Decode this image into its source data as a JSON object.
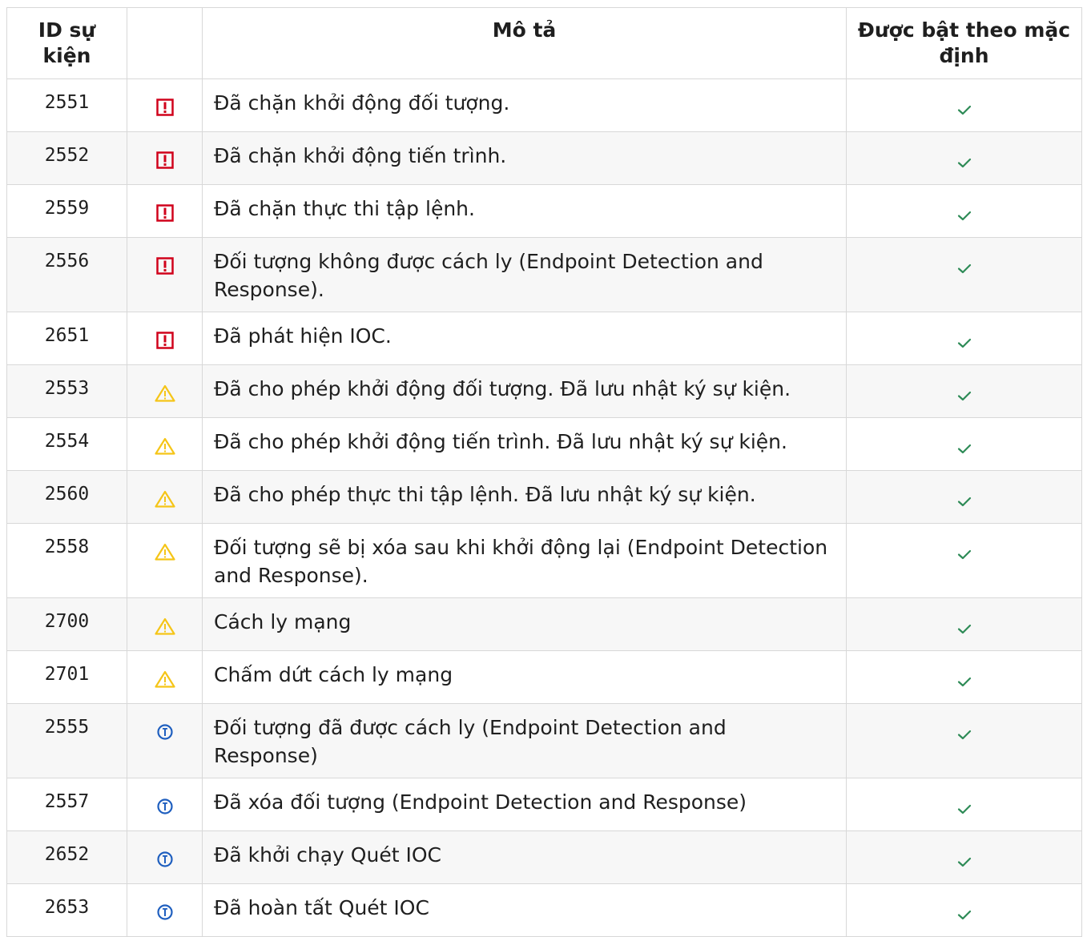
{
  "columns": {
    "event_id": "ID sự kiện",
    "icon": "",
    "description": "Mô tả",
    "enabled_by_default": "Được bật theo mặc định"
  },
  "colors": {
    "critical": "#d0021b",
    "warning": "#f5c518",
    "info": "#1f5fbf",
    "check": "#2e8b57"
  },
  "rows": [
    {
      "id": "2551",
      "severity": "critical-icon",
      "description": "Đã chặn khởi động đối tượng.",
      "enabled": "check-icon"
    },
    {
      "id": "2552",
      "severity": "critical-icon",
      "description": "Đã chặn khởi động tiến trình.",
      "enabled": "check-icon"
    },
    {
      "id": "2559",
      "severity": "critical-icon",
      "description": "Đã chặn thực thi tập lệnh.",
      "enabled": "check-icon"
    },
    {
      "id": "2556",
      "severity": "critical-icon",
      "description": "Đối tượng không được cách ly (Endpoint Detection and Response).",
      "enabled": "check-icon"
    },
    {
      "id": "2651",
      "severity": "critical-icon",
      "description": "Đã phát hiện IOC.",
      "enabled": "check-icon"
    },
    {
      "id": "2553",
      "severity": "warning-icon",
      "description": "Đã cho phép khởi động đối tượng. Đã lưu nhật ký sự kiện.",
      "enabled": "check-icon"
    },
    {
      "id": "2554",
      "severity": "warning-icon",
      "description": "Đã cho phép khởi động tiến trình. Đã lưu nhật ký sự kiện.",
      "enabled": "check-icon"
    },
    {
      "id": "2560",
      "severity": "warning-icon",
      "description": "Đã cho phép thực thi tập lệnh. Đã lưu nhật ký sự kiện.",
      "enabled": "check-icon"
    },
    {
      "id": "2558",
      "severity": "warning-icon",
      "description": "Đối tượng sẽ bị xóa sau khi khởi động lại (Endpoint Detection and Response).",
      "enabled": "check-icon"
    },
    {
      "id": "2700",
      "severity": "warning-icon",
      "description": "Cách ly mạng",
      "enabled": "check-icon"
    },
    {
      "id": "2701",
      "severity": "warning-icon",
      "description": "Chấm dứt cách ly mạng",
      "enabled": "check-icon"
    },
    {
      "id": "2555",
      "severity": "info-icon",
      "description": "Đối tượng đã được cách ly (Endpoint Detection and Response)",
      "enabled": "check-icon"
    },
    {
      "id": "2557",
      "severity": "info-icon",
      "description": "Đã xóa đối tượng (Endpoint Detection and Response)",
      "enabled": "check-icon"
    },
    {
      "id": "2652",
      "severity": "info-icon",
      "description": "Đã khởi chạy Quét IOC",
      "enabled": "check-icon"
    },
    {
      "id": "2653",
      "severity": "info-icon",
      "description": "Đã hoàn tất Quét IOC",
      "enabled": "check-icon"
    }
  ]
}
